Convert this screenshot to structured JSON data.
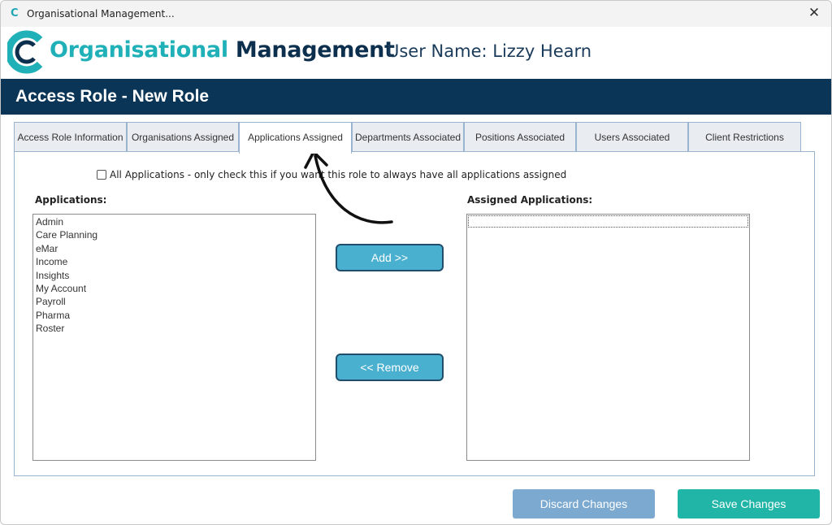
{
  "window": {
    "title": "Organisational Management...",
    "app_icon": "C",
    "close_glyph": "✕"
  },
  "brand": {
    "name_part1": "Organisational ",
    "name_part2": "Management",
    "user_label": "User Name: Lizzy Hearn",
    "colors": {
      "teal": "#1fb0b8",
      "navy": "#0b2f4d"
    }
  },
  "page": {
    "title": "Access Role - New Role"
  },
  "tabs": [
    {
      "label": "Access Role Information",
      "active": false
    },
    {
      "label": "Organisations Assigned",
      "active": false
    },
    {
      "label": "Applications Assigned",
      "active": true
    },
    {
      "label": "Departments Associated",
      "active": false
    },
    {
      "label": "Positions Associated",
      "active": false
    },
    {
      "label": "Users Associated",
      "active": false
    },
    {
      "label": "Client Restrictions",
      "active": false
    }
  ],
  "all_apps_checkbox": {
    "label": "All Applications - only check this if you want this role to always have all applications assigned",
    "checked": false
  },
  "applications": {
    "label": "Applications:",
    "items": [
      "Admin",
      "Care Planning",
      "eMar",
      "Income",
      "Insights",
      "My Account",
      "Payroll",
      "Pharma",
      "Roster"
    ]
  },
  "assigned": {
    "label": "Assigned Applications:",
    "items": []
  },
  "buttons": {
    "add": "Add  >>",
    "remove": "<< Remove",
    "discard": "Discard Changes",
    "save": "Save Changes"
  }
}
